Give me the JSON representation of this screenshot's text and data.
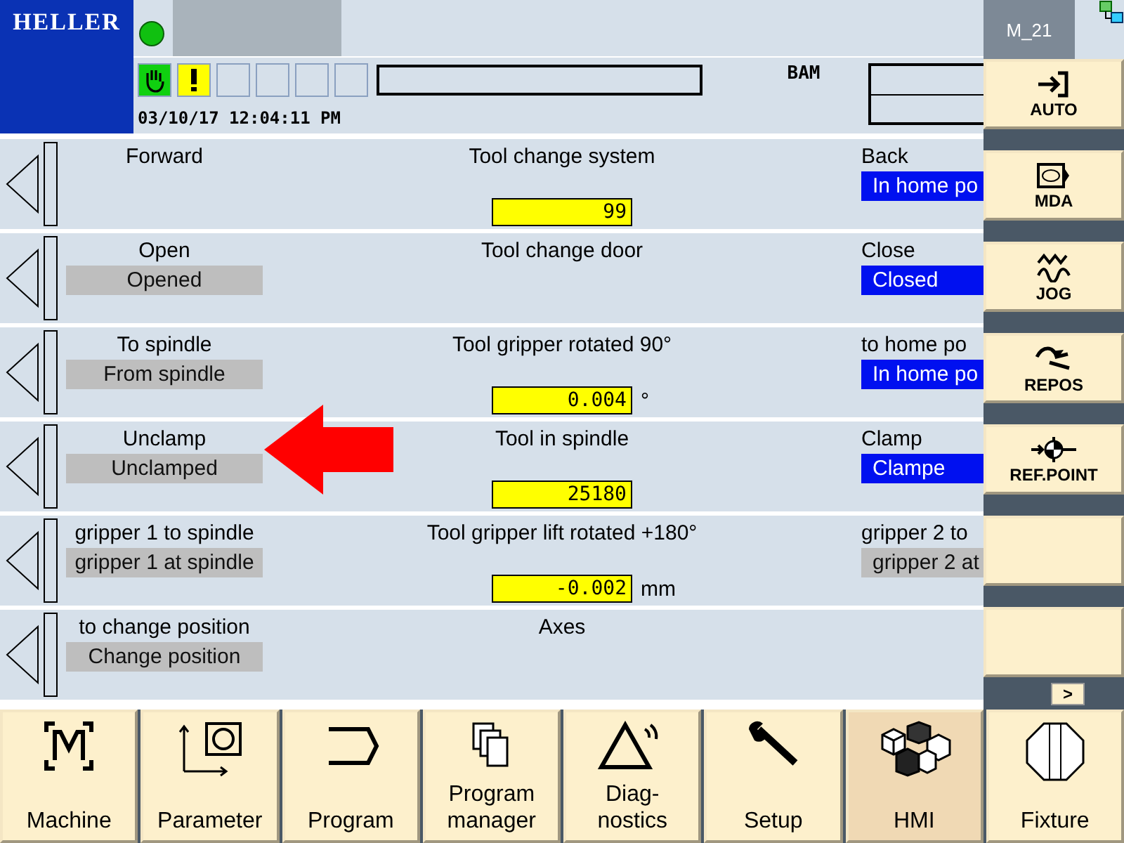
{
  "header": {
    "logo": "HELLER",
    "datetime": "03/10/17 12:04:11 PM",
    "channel": "BAM",
    "machine": "M_21"
  },
  "rows": [
    {
      "title": "Tool change system",
      "left": {
        "label": "Forward"
      },
      "right": {
        "label": "Back",
        "status": {
          "text": "In home po",
          "active": true
        }
      },
      "value": "99"
    },
    {
      "title": "Tool change door",
      "left": {
        "label": "Open",
        "status": {
          "text": "Opened",
          "active": false
        }
      },
      "right": {
        "label": "Close",
        "status": {
          "text": "Closed",
          "active": true
        }
      }
    },
    {
      "title": "Tool gripper rotated 90°",
      "left": {
        "label": "To spindle",
        "status": {
          "text": "From spindle",
          "active": false
        }
      },
      "right": {
        "label": "to home po",
        "status": {
          "text": "In home po",
          "active": true
        }
      },
      "value": "0.004",
      "unit": "°"
    },
    {
      "title": "Tool in spindle",
      "left": {
        "label": "Unclamp",
        "status": {
          "text": "Unclamped",
          "active": false
        }
      },
      "right": {
        "label": "Clamp",
        "status": {
          "text": "Clampe",
          "active": true
        }
      },
      "value": "25180",
      "pointer": true
    },
    {
      "title": "Tool gripper lift rotated +180°",
      "left": {
        "label": "gripper 1 to spindle",
        "status": {
          "text": "gripper 1 at spindle",
          "active": false
        }
      },
      "right": {
        "label": "gripper 2 to",
        "status": {
          "text": "gripper 2 at",
          "active": false
        }
      },
      "value": "-0.002",
      "unit": "mm"
    },
    {
      "title": "Axes",
      "left": {
        "label": "to change position",
        "status": {
          "text": "Change position",
          "active": false
        }
      }
    }
  ],
  "modes": [
    {
      "kind": "auto",
      "label": "AUTO"
    },
    {
      "kind": "mda",
      "label": "MDA"
    },
    {
      "kind": "jog",
      "label": "JOG"
    },
    {
      "kind": "repos",
      "label": "REPOS"
    },
    {
      "kind": "refpoint",
      "label": "REF.POINT"
    },
    {
      "kind": "blank"
    },
    {
      "kind": "blank"
    }
  ],
  "more_button": ">",
  "bottom_tabs": [
    {
      "kind": "machine",
      "label": "Machine",
      "selected": false
    },
    {
      "kind": "parameter",
      "label": "Parameter",
      "selected": false
    },
    {
      "kind": "program",
      "label": "Program",
      "selected": false
    },
    {
      "kind": "manager",
      "label": "Program\nmanager",
      "selected": false
    },
    {
      "kind": "diagnostics",
      "label": "Diag-\nnostics",
      "selected": false
    },
    {
      "kind": "setup",
      "label": "Setup",
      "selected": false
    },
    {
      "kind": "hmi",
      "label": "HMI",
      "selected": true
    },
    {
      "kind": "fixture",
      "label": "Fixture",
      "selected": false
    }
  ]
}
